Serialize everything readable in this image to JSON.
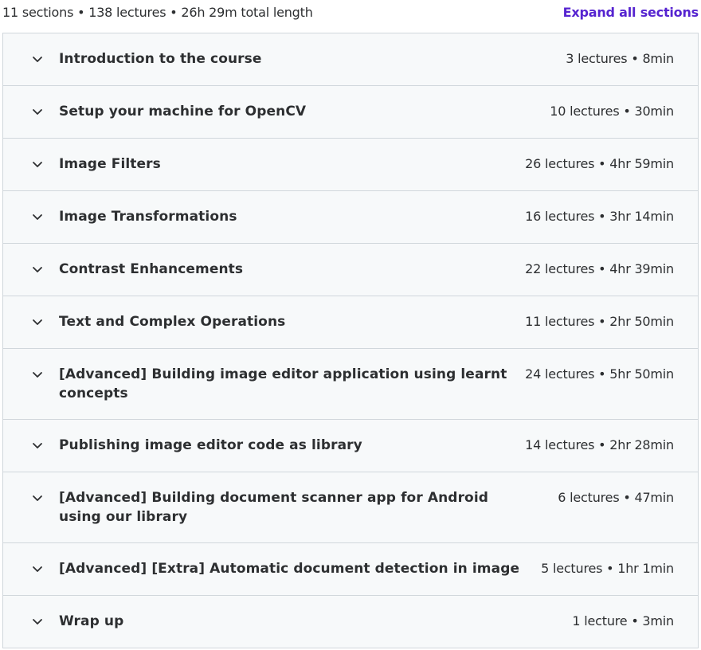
{
  "curriculum": {
    "summary": "11 sections • 138 lectures • 26h 29m total length",
    "expand_all_label": "Expand all sections",
    "sections": [
      {
        "title": "Introduction to the course",
        "meta": "3 lectures • 8min"
      },
      {
        "title": "Setup your machine for OpenCV",
        "meta": "10 lectures • 30min"
      },
      {
        "title": "Image Filters",
        "meta": "26 lectures • 4hr 59min"
      },
      {
        "title": "Image Transformations",
        "meta": "16 lectures • 3hr 14min"
      },
      {
        "title": "Contrast Enhancements",
        "meta": "22 lectures • 4hr 39min"
      },
      {
        "title": "Text and Complex Operations",
        "meta": "11 lectures • 2hr 50min"
      },
      {
        "title": "[Advanced] Building image editor application using learnt concepts",
        "meta": "24 lectures • 5hr 50min"
      },
      {
        "title": "Publishing image editor code as library",
        "meta": "14 lectures • 2hr 28min"
      },
      {
        "title": "[Advanced] Building document scanner app for Android using our library",
        "meta": "6 lectures • 47min"
      },
      {
        "title": "[Advanced] [Extra] Automatic document detection in image",
        "meta": "5 lectures • 1hr 1min"
      },
      {
        "title": "Wrap up",
        "meta": "1 lecture • 3min"
      }
    ]
  },
  "icons": {
    "section_toggle": "chevron-down-icon"
  },
  "colors": {
    "accent": "#5624d0",
    "section_bg": "#f7f9fa",
    "border": "#d1d7dc",
    "text": "#2d2f31"
  }
}
